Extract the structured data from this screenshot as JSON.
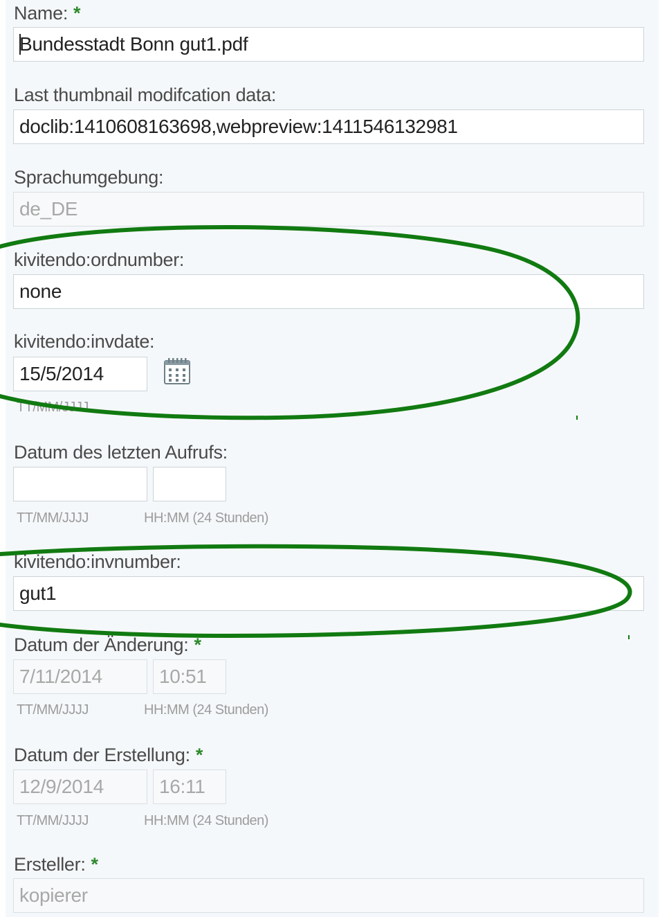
{
  "fields": {
    "name": {
      "label": "Name:",
      "required": "*",
      "value": "Bundesstadt Bonn gut1.pdf"
    },
    "thumbnail": {
      "label": "Last thumbnail modifcation data:",
      "value": "doclib:1410608163698,webpreview:1411546132981"
    },
    "locale": {
      "label": "Sprachumgebung:",
      "value": "de_DE"
    },
    "ordnumber": {
      "label": "kivitendo:ordnumber:",
      "value": "none"
    },
    "invdate": {
      "label": "kivitendo:invdate:",
      "value": "15/5/2014",
      "hint": "TT/MM/JJJJ"
    },
    "last_access": {
      "label": "Datum des letzten Aufrufs:",
      "date_value": "",
      "time_value": "",
      "date_hint": "TT/MM/JJJJ",
      "time_hint": "HH:MM (24 Stunden)"
    },
    "invnumber": {
      "label": "kivitendo:invnumber:",
      "value": "gut1"
    },
    "modified": {
      "label": "Datum der Änderung:",
      "required": "*",
      "date_value": "7/11/2014",
      "time_value": "10:51",
      "date_hint": "TT/MM/JJJJ",
      "time_hint": "HH:MM (24 Stunden)"
    },
    "created": {
      "label": "Datum der Erstellung:",
      "required": "*",
      "date_value": "12/9/2014",
      "time_value": "16:11",
      "date_hint": "TT/MM/JJJJ",
      "time_hint": "HH:MM (24 Stunden)"
    },
    "creator": {
      "label": "Ersteller:",
      "required": "*",
      "value": "kopierer"
    }
  },
  "icons": {
    "calendar": "calendar-icon"
  },
  "colors": {
    "annotation": "#117a11",
    "required": "#2d8a2d"
  }
}
